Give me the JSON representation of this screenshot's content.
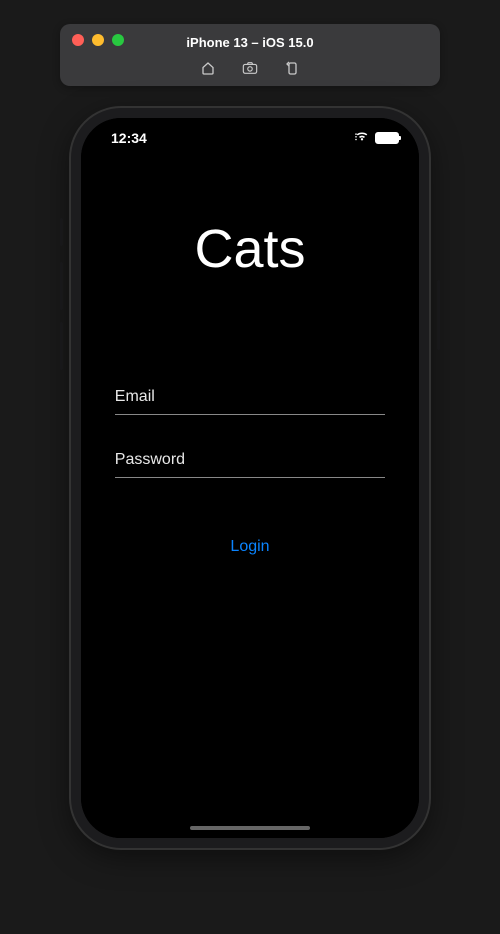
{
  "simulator": {
    "title": "iPhone 13 – iOS 15.0"
  },
  "statusBar": {
    "time": "12:34"
  },
  "app": {
    "title": "Cats",
    "emailPlaceholder": "Email",
    "passwordPlaceholder": "Password",
    "loginLabel": "Login"
  }
}
